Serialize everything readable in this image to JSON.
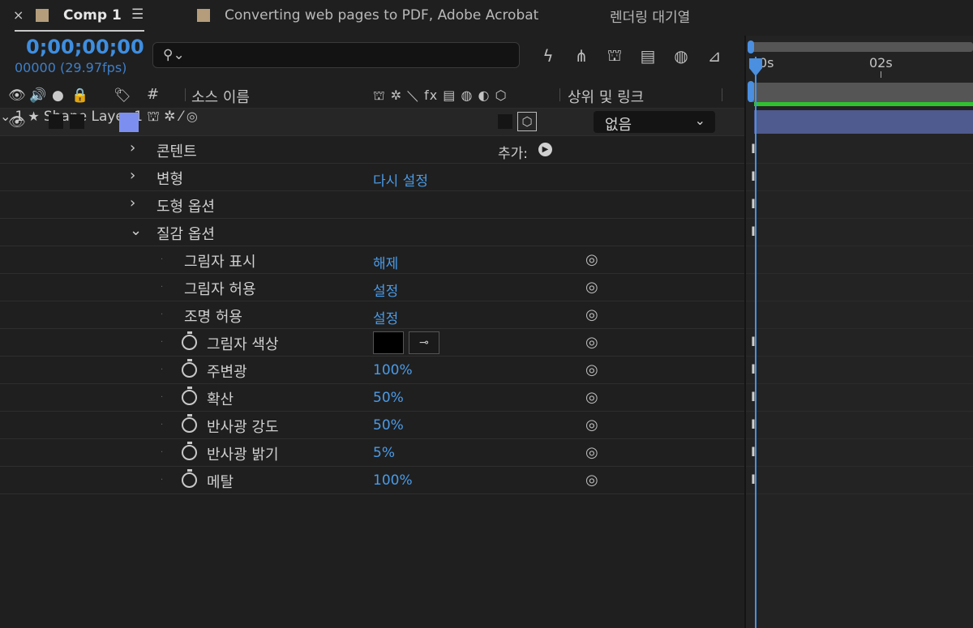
{
  "tabs": {
    "close": "×",
    "active": "Comp 1",
    "menu": "☰",
    "second": "Converting web pages to PDF, Adobe Acrobat",
    "third": "렌더링 대기열"
  },
  "time": {
    "timecode": "0;00;00;00",
    "fps": "00000 (29.97fps)"
  },
  "search": {
    "icon": "search-icon",
    "glyph": "⚲⌄"
  },
  "toolbar": [
    {
      "name": "draft-3d-icon",
      "glyph": "ϟ"
    },
    {
      "name": "flowchart-icon",
      "glyph": "⋔"
    },
    {
      "name": "shy-icon",
      "glyph": "⛫"
    },
    {
      "name": "frame-blending-icon",
      "glyph": "▤"
    },
    {
      "name": "motion-blur-icon",
      "glyph": "◍"
    },
    {
      "name": "graph-editor-icon",
      "glyph": "⊿"
    }
  ],
  "columns": {
    "eye": "👁",
    "audio": "🔊",
    "solo": "●",
    "lock": "🔒",
    "label": "🏷",
    "number": "#",
    "source_name": "소스 이름",
    "switches": "⛫ ✲ ⟍ fx ▤ ◍ ◐ ⬡",
    "parent": "상위 및 링크"
  },
  "layer": {
    "number": "1",
    "star": "★",
    "name": "Shape Layer 1",
    "switch_glyphs": "⛫ ✲ ⁄",
    "parent_value": "없음",
    "pickwhip": "◎",
    "label_color": "#7c8ff0"
  },
  "groups": [
    {
      "label": "콘텐트",
      "expanded": false,
      "extra": "추가:"
    },
    {
      "label": "변형",
      "expanded": false,
      "value": "다시 설정"
    },
    {
      "label": "도형 옵션",
      "expanded": false
    },
    {
      "label": "질감 옵션",
      "expanded": true
    }
  ],
  "props": [
    {
      "label": "그림자 표시",
      "value": "해제",
      "stopwatch": false
    },
    {
      "label": "그림자 허용",
      "value": "설정",
      "stopwatch": false
    },
    {
      "label": "조명 허용",
      "value": "설정",
      "stopwatch": false
    },
    {
      "label": "그림자 색상",
      "value": "",
      "stopwatch": true,
      "color": "#000000"
    },
    {
      "label": "주변광",
      "value": "100%",
      "stopwatch": true
    },
    {
      "label": "확산",
      "value": "50%",
      "stopwatch": true
    },
    {
      "label": "반사광 강도",
      "value": "50%",
      "stopwatch": true
    },
    {
      "label": "반사광 밝기",
      "value": "5%",
      "stopwatch": true
    },
    {
      "label": "메탈",
      "value": "100%",
      "stopwatch": true
    }
  ],
  "timeline": {
    "ruler_start": "0s",
    "ruler_mark": "02s",
    "keyframe_glyph": "I"
  }
}
